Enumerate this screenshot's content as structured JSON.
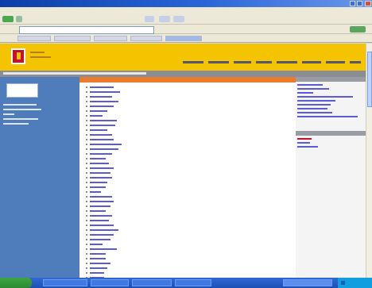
{
  "browser": {
    "window_title": "",
    "address_value": "",
    "menu_items": [],
    "link_buttons": []
  },
  "site": {
    "logo_text": "",
    "nav_items": [],
    "breadcrumb": "",
    "left_links": [],
    "center_heading": "",
    "center_links": [],
    "right_box1_title": "",
    "right_box1_links": [],
    "right_box2_title": "",
    "right_box2_links": []
  },
  "taskbar": {
    "start_label": "",
    "tasks": [],
    "clock": ""
  },
  "colors": {
    "header": "#f5c400",
    "logo_red": "#c8102e",
    "left_panel": "#4f7cbb",
    "center_bar": "#e87b2c",
    "link": "#5b5bd6",
    "taskbar": "#245edb"
  },
  "icons": [
    "window-minimize-icon",
    "window-maximize-icon",
    "window-close-icon",
    "back-icon",
    "forward-icon",
    "logo-icon",
    "start-icon",
    "tray-icon"
  ]
}
